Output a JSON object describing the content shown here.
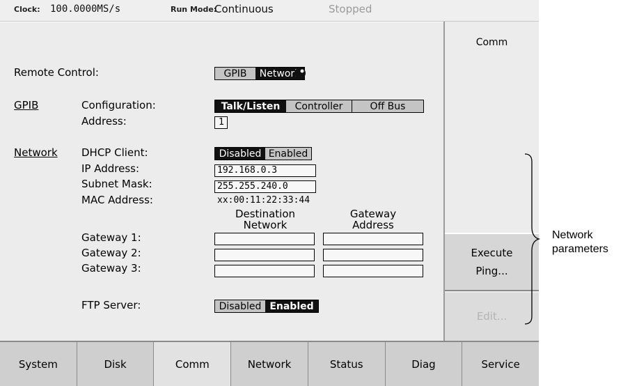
{
  "status_bar": {
    "clock_label": "Clock:",
    "clock_value": "100.0000MS/s",
    "run_mode_label": "Run Mode:",
    "run_mode_value": "Continuous",
    "state": "Stopped"
  },
  "remote_control": {
    "label": "Remote Control:",
    "options": [
      "GPIB",
      "Network"
    ],
    "selected": "Network"
  },
  "gpib": {
    "section": "GPIB",
    "configuration_label": "Configuration:",
    "configuration_options": [
      "Talk/Listen",
      "Controller",
      "Off Bus"
    ],
    "configuration_selected": "Talk/Listen",
    "address_label": "Address:",
    "address_value": "1"
  },
  "network": {
    "section": "Network",
    "dhcp_label": "DHCP Client:",
    "dhcp_options": [
      "Disabled",
      "Enabled"
    ],
    "dhcp_selected": "Disabled",
    "ip_label": "IP Address:",
    "ip_value": "192.168.0.3",
    "subnet_label": "Subnet Mask:",
    "subnet_value": "255.255.240.0",
    "mac_label": "MAC Address:",
    "mac_value": "xx:00:11:22:33:44",
    "dest_header_line1": "Destination",
    "dest_header_line2": "Network",
    "gw_header_line1": "Gateway",
    "gw_header_line2": "Address",
    "gateways": [
      {
        "label": "Gateway 1:",
        "destination": "",
        "address": ""
      },
      {
        "label": "Gateway 2:",
        "destination": "",
        "address": ""
      },
      {
        "label": "Gateway 3:",
        "destination": "",
        "address": ""
      }
    ],
    "ftp_label": "FTP Server:",
    "ftp_options": [
      "Disabled",
      "Enabled"
    ],
    "ftp_selected": "Enabled"
  },
  "side_menu": {
    "title": "Comm",
    "execute_line1": "Execute",
    "execute_line2": "Ping...",
    "edit_label": "Edit..."
  },
  "bottom_tabs": [
    "System",
    "Disk",
    "Comm",
    "Network",
    "Status",
    "Diag",
    "Service"
  ],
  "active_tab": "Comm",
  "callout": {
    "line1": "Network",
    "line2": "parameters"
  }
}
